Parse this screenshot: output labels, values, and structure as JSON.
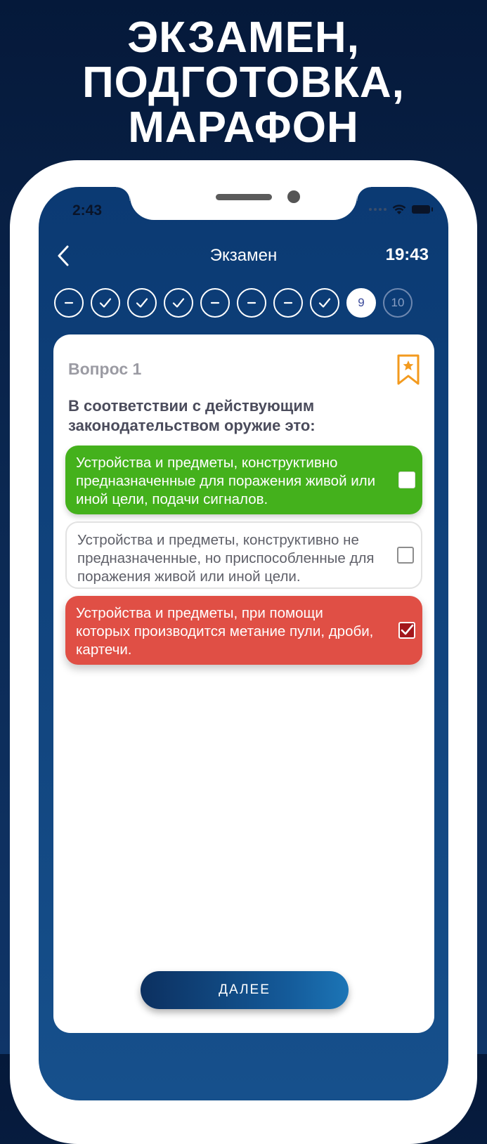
{
  "headline": {
    "line1": "ЭКЗАМЕН,",
    "line2": "ПОДГОТОВКА,",
    "line3": "МАРАФОН"
  },
  "status_bar": {
    "time": "2:43",
    "icons": [
      "signal-dots-icon",
      "wifi-icon",
      "battery-icon"
    ]
  },
  "nav": {
    "title": "Экзамен",
    "timer": "19:43",
    "back_icon": "chevron-left-icon"
  },
  "progress": {
    "current": 9,
    "steps": [
      {
        "label": "",
        "state": "skipped",
        "icon": "minus-icon"
      },
      {
        "label": "",
        "state": "answered",
        "icon": "check-icon"
      },
      {
        "label": "",
        "state": "answered",
        "icon": "check-icon"
      },
      {
        "label": "",
        "state": "answered",
        "icon": "check-icon"
      },
      {
        "label": "",
        "state": "skipped",
        "icon": "minus-icon"
      },
      {
        "label": "",
        "state": "skipped",
        "icon": "minus-icon"
      },
      {
        "label": "",
        "state": "skipped",
        "icon": "minus-icon"
      },
      {
        "label": "",
        "state": "answered",
        "icon": "check-icon"
      },
      {
        "label": "9",
        "state": "current",
        "icon": ""
      },
      {
        "label": "10",
        "state": "future",
        "icon": ""
      }
    ]
  },
  "question": {
    "number_label": "Вопрос 1",
    "text": "В соответствии с действующим законодательством оружие это:",
    "bookmark_icon": "bookmark-star-icon",
    "answers": [
      {
        "text": "Устройства и предметы, конструктивно предназначенные для поражения живой или иной цели, подачи сигналов.",
        "state": "correct",
        "checked": false
      },
      {
        "text": "Устройства и предметы, конструктивно не предназначенные, но приспособленные для поражения живой или иной цели.",
        "state": "neutral",
        "checked": false
      },
      {
        "text": "Устройства и предметы, при помощи которых производится метание пули, дроби, картечи.",
        "state": "wrong",
        "checked": true
      }
    ]
  },
  "next_button": {
    "label": "ДАЛЕЕ"
  },
  "colors": {
    "background": "#0c2a55",
    "screen": "#0b3a73",
    "correct": "#44b11c",
    "wrong": "#e04f45",
    "bookmark": "#f39a1e"
  }
}
